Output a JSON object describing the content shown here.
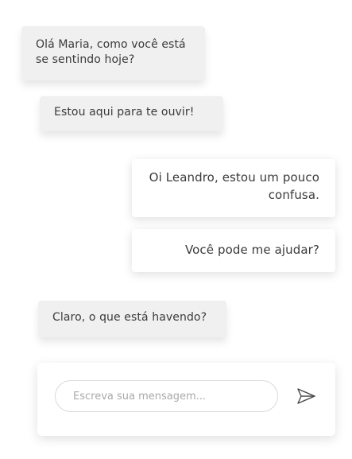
{
  "messages": [
    {
      "from": "therapist",
      "text": "Olá Maria, como você está se sentindo hoje?"
    },
    {
      "from": "therapist",
      "text": "Estou aqui para te ouvir!"
    },
    {
      "from": "user",
      "text": "Oi Leandro, estou um pouco confusa."
    },
    {
      "from": "user",
      "text": "Você pode me ajudar?"
    },
    {
      "from": "therapist",
      "text": "Claro, o que está havendo?"
    }
  ],
  "composer": {
    "placeholder": "Escreva sua mensagem...",
    "value": "",
    "send_icon": "send-arrow-icon"
  },
  "colors": {
    "incoming_bg": "#f0f0f0",
    "outgoing_bg": "#ffffff",
    "text": "#3a3a3a",
    "placeholder": "#a9a9a9"
  }
}
